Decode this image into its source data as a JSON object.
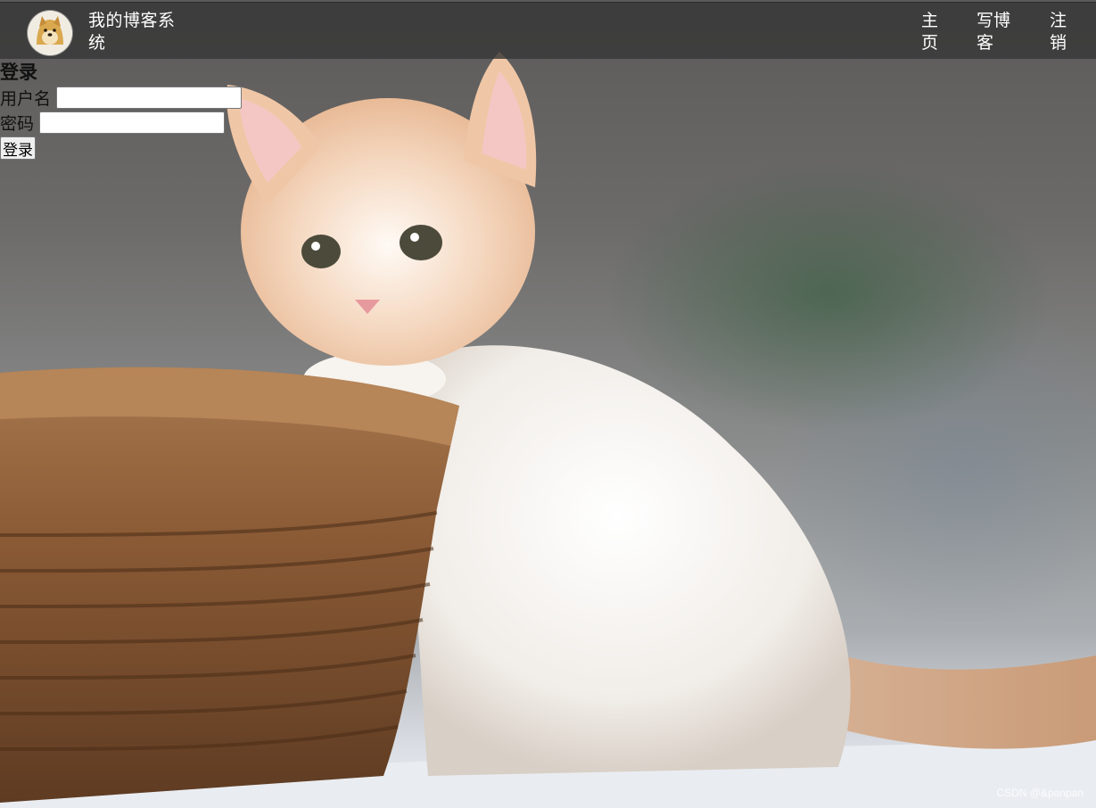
{
  "header": {
    "site_title": "我的博客系统",
    "nav": {
      "home": "主页",
      "write": "写博客",
      "logout": "注销"
    }
  },
  "login": {
    "heading": "登录",
    "username_label": "用户名",
    "username_value": "",
    "password_label": "密码",
    "password_value": "",
    "submit_label": "登录"
  },
  "background": {
    "watermark": "CSDN @&panpan"
  },
  "icons": {
    "avatar": "doge-avatar-icon"
  },
  "colors": {
    "header_bg": "#373737",
    "header_text": "#ffffff"
  }
}
